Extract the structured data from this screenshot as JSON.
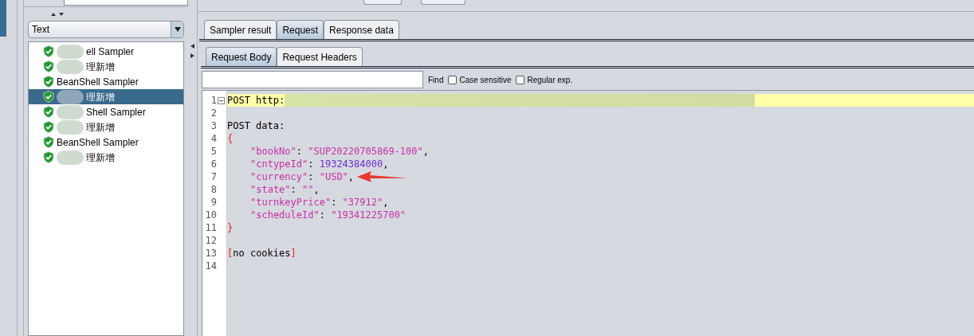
{
  "view_selector": {
    "value": "Text"
  },
  "tree": [
    {
      "label": "ell Sampler",
      "redacted": true,
      "selected": false
    },
    {
      "label": "理新增",
      "redacted": true,
      "selected": false
    },
    {
      "label": "BeanShell Sampler",
      "redacted": false,
      "selected": false
    },
    {
      "label": "理新增",
      "redacted": true,
      "selected": true
    },
    {
      "label": "Shell Sampler",
      "redacted": true,
      "selected": false
    },
    {
      "label": "理新增",
      "redacted": true,
      "selected": false
    },
    {
      "label": "BeanShell Sampler",
      "redacted": false,
      "selected": false
    },
    {
      "label": "理新增",
      "redacted": true,
      "selected": false
    }
  ],
  "tabs": [
    {
      "label": "Sampler result",
      "selected": false
    },
    {
      "label": "Request",
      "selected": true
    },
    {
      "label": "Response data",
      "selected": false
    }
  ],
  "sub_tabs": [
    {
      "label": "Request Body",
      "selected": true
    },
    {
      "label": "Request Headers",
      "selected": false
    }
  ],
  "find": {
    "label": "Find",
    "options": [
      {
        "label": "Case sensitive",
        "checked": false
      },
      {
        "label": "Regular exp.",
        "checked": false
      }
    ]
  },
  "code_lines": [
    {
      "number": "1",
      "foldable": true,
      "highlighted": true,
      "redacted": true,
      "indented": false,
      "arrow": false,
      "tokens": [
        {
          "kind": "text",
          "text": "POST http:"
        }
      ]
    },
    {
      "number": "2",
      "foldable": false,
      "highlighted": false,
      "redacted": false,
      "arrow": false
    },
    {
      "number": "3",
      "foldable": false,
      "highlighted": false,
      "redacted": false,
      "indented": false,
      "arrow": false,
      "tokens": [
        {
          "kind": "text",
          "text": "POST data:"
        }
      ]
    },
    {
      "number": "4",
      "foldable": false,
      "highlighted": false,
      "redacted": false,
      "indented": false,
      "arrow": false,
      "tokens": [
        {
          "kind": "bracket",
          "text": "{"
        }
      ]
    },
    {
      "number": "5",
      "foldable": false,
      "highlighted": false,
      "redacted": false,
      "indented": true,
      "arrow": false,
      "tokens": [
        {
          "kind": "key",
          "text": "\"bookNo\""
        },
        {
          "kind": "punct",
          "text": ": "
        },
        {
          "kind": "string",
          "text": "\"SUP20220705869-100\""
        },
        {
          "kind": "punct",
          "text": ","
        }
      ]
    },
    {
      "number": "6",
      "foldable": false,
      "highlighted": false,
      "redacted": false,
      "indented": true,
      "arrow": false,
      "tokens": [
        {
          "kind": "key",
          "text": "\"cntypeId\""
        },
        {
          "kind": "punct",
          "text": ": "
        },
        {
          "kind": "number",
          "text": "19324384000"
        },
        {
          "kind": "punct",
          "text": ","
        }
      ]
    },
    {
      "number": "7",
      "foldable": false,
      "highlighted": false,
      "redacted": false,
      "indented": true,
      "arrow": true,
      "tokens": [
        {
          "kind": "key",
          "text": "\"currency\""
        },
        {
          "kind": "punct",
          "text": ": "
        },
        {
          "kind": "string",
          "text": "\"USD\""
        },
        {
          "kind": "punct",
          "text": ","
        }
      ]
    },
    {
      "number": "8",
      "foldable": false,
      "highlighted": false,
      "redacted": false,
      "indented": true,
      "arrow": false,
      "tokens": [
        {
          "kind": "key",
          "text": "\"state\""
        },
        {
          "kind": "punct",
          "text": ": "
        },
        {
          "kind": "string",
          "text": "\"\""
        },
        {
          "kind": "punct",
          "text": ","
        }
      ]
    },
    {
      "number": "9",
      "foldable": false,
      "highlighted": false,
      "redacted": false,
      "indented": true,
      "arrow": false,
      "tokens": [
        {
          "kind": "key",
          "text": "\"turnkeyPrice\""
        },
        {
          "kind": "punct",
          "text": ": "
        },
        {
          "kind": "string",
          "text": "\"37912\""
        },
        {
          "kind": "punct",
          "text": ","
        }
      ]
    },
    {
      "number": "10",
      "foldable": false,
      "highlighted": false,
      "redacted": false,
      "indented": true,
      "arrow": false,
      "tokens": [
        {
          "kind": "key",
          "text": "\"scheduleId\""
        },
        {
          "kind": "punct",
          "text": ": "
        },
        {
          "kind": "string",
          "text": "\"19341225700\""
        }
      ]
    },
    {
      "number": "11",
      "foldable": false,
      "highlighted": false,
      "redacted": false,
      "indented": false,
      "arrow": false,
      "tokens": [
        {
          "kind": "bracket",
          "text": "}"
        }
      ]
    },
    {
      "number": "12",
      "foldable": false,
      "highlighted": false,
      "redacted": false,
      "arrow": false
    },
    {
      "number": "13",
      "foldable": false,
      "highlighted": false,
      "redacted": false,
      "indented": false,
      "arrow": false,
      "tokens": [
        {
          "kind": "bracket",
          "text": "["
        },
        {
          "kind": "text",
          "text": "no cookies"
        },
        {
          "kind": "bracket",
          "text": "]"
        }
      ]
    },
    {
      "number": "14",
      "foldable": false,
      "highlighted": false,
      "redacted": false,
      "arrow": false
    }
  ]
}
